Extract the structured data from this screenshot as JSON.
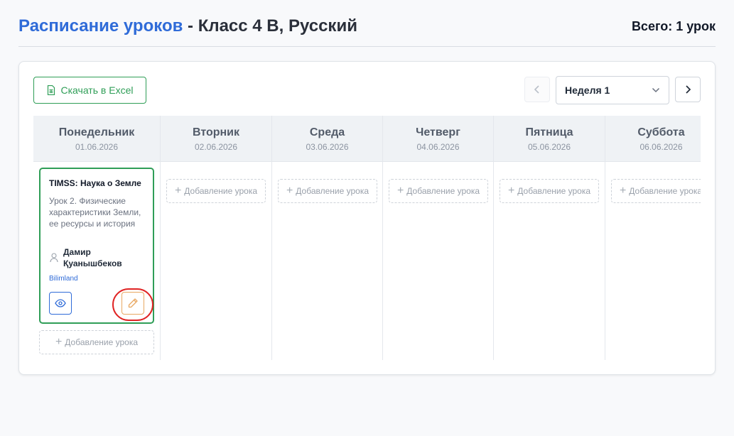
{
  "header": {
    "title_accent": "Расписание уроков",
    "title_rest": " - Класс 4 В, Русский",
    "total": "Всего: 1 урок"
  },
  "toolbar": {
    "excel_label": "Скачать в Excel",
    "week_value": "Неделя 1"
  },
  "days": [
    {
      "name": "Понедельник",
      "date": "01.06.2026"
    },
    {
      "name": "Вторник",
      "date": "02.06.2026"
    },
    {
      "name": "Среда",
      "date": "03.06.2026"
    },
    {
      "name": "Четверг",
      "date": "04.06.2026"
    },
    {
      "name": "Пятница",
      "date": "05.06.2026"
    },
    {
      "name": "Суббота",
      "date": "06.06.2026"
    }
  ],
  "add_label": "Добавление урока",
  "lesson": {
    "title": "TIMSS: Наука о Земле",
    "description": "Урок 2. Физические характеристики Земли, ее ресурсы и история",
    "teacher": "Дамир Қуанышбеков",
    "platform": "Bilimland"
  },
  "colors": {
    "accent": "#2f6bd8",
    "success": "#2f9e57",
    "edit": "#e8a862",
    "highlight": "#e02424"
  },
  "icons": {
    "excel": "spreadsheet-icon",
    "prev": "chevron-left-icon",
    "next": "chevron-right-icon",
    "dropdown": "chevron-down-icon",
    "teacher": "user-icon",
    "view": "eye-icon",
    "edit": "pencil-icon",
    "add": "plus-icon"
  }
}
